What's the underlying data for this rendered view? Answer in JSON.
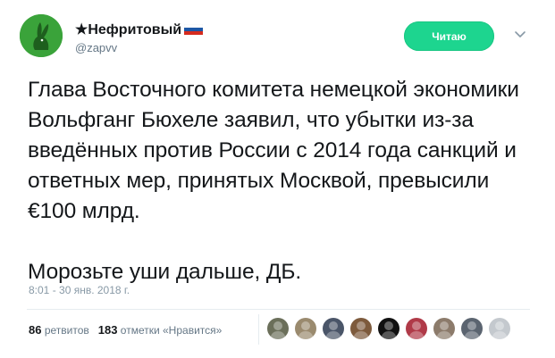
{
  "header": {
    "display_name": "★Нефритовый",
    "handle": "@zapvv",
    "follow_label": "Читаю"
  },
  "tweet": {
    "paragraphs": [
      "Глава Восточного комитета немецкой экономики Вольфганг Бюхеле заявил, что убытки из-за введённых против России с 2014 года санкций и ответных мер, принятых Москвой, превысили €100 млрд.",
      "Морозьте уши дальше, ДБ."
    ],
    "timestamp": "8:01 - 30 янв. 2018 г."
  },
  "stats": {
    "retweets_count": "86",
    "retweets_label": "ретвитов",
    "likes_count": "183",
    "likes_label": "отметки «Нравится»"
  },
  "likers": [
    {
      "icon": "user-avatar",
      "color": "#6b6f5a"
    },
    {
      "icon": "user-avatar",
      "color": "#9a8a6e"
    },
    {
      "icon": "user-avatar",
      "color": "#4a5568"
    },
    {
      "icon": "user-avatar",
      "color": "#7d5a3c"
    },
    {
      "icon": "user-avatar",
      "color": "#111111"
    },
    {
      "icon": "user-avatar",
      "color": "#b03a48"
    },
    {
      "icon": "user-avatar",
      "color": "#8c7b6b"
    },
    {
      "icon": "user-avatar",
      "color": "#5b6470"
    },
    {
      "icon": "user-avatar",
      "color": "#c4c9ce"
    }
  ],
  "colors": {
    "follow_button": "#1dd58f",
    "avatar_background": "#3aa33a",
    "flag_white": "#ffffff",
    "flag_blue": "#1c57a5",
    "flag_red": "#d52b1e"
  }
}
